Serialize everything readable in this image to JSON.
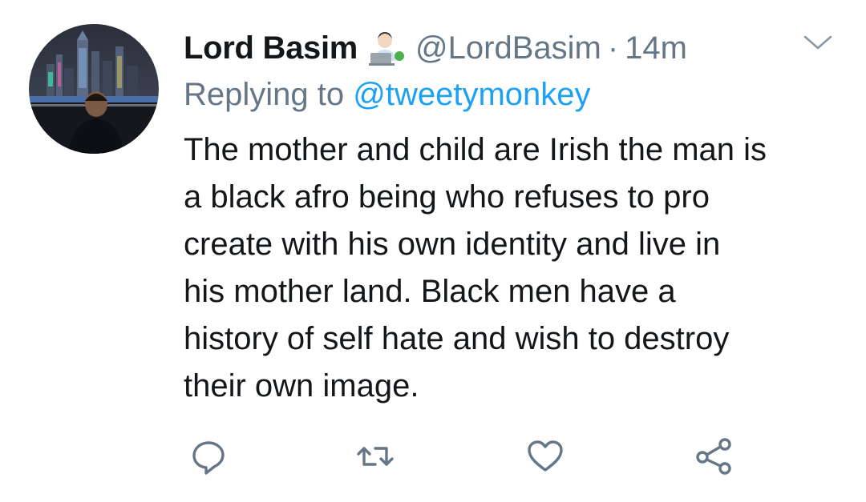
{
  "tweet": {
    "display_name": "Lord Basim",
    "name_emoji": "technologist-emoji",
    "handle": "@LordBasim",
    "separator": "·",
    "time": "14m",
    "reply_prefix": "Replying to",
    "reply_to": "@tweetymonkey",
    "body_lines": [
      "The mother and child are Irish the man is",
      "a black afro being who refuses to pro",
      "create with his own identity and live in",
      "his mother land. Black men have a",
      "history of self hate and wish to destroy",
      "their own image."
    ]
  },
  "icons": {
    "menu": "chevron-down-icon",
    "reply": "reply-icon",
    "retweet": "retweet-icon",
    "like": "heart-icon",
    "share": "share-icon"
  },
  "colors": {
    "text": "#14171a",
    "muted": "#657786",
    "link": "#1da1f2",
    "icon": "#657786"
  }
}
